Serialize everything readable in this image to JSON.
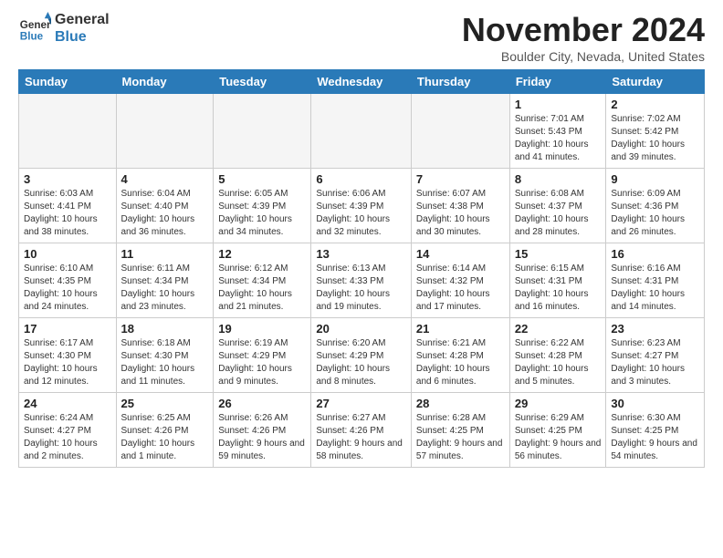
{
  "header": {
    "logo_line1": "General",
    "logo_line2": "Blue",
    "month": "November 2024",
    "location": "Boulder City, Nevada, United States"
  },
  "days_of_week": [
    "Sunday",
    "Monday",
    "Tuesday",
    "Wednesday",
    "Thursday",
    "Friday",
    "Saturday"
  ],
  "weeks": [
    [
      null,
      null,
      null,
      null,
      null,
      {
        "day": "1",
        "sunrise": "7:01 AM",
        "sunset": "5:43 PM",
        "daylight": "10 hours and 41 minutes."
      },
      {
        "day": "2",
        "sunrise": "7:02 AM",
        "sunset": "5:42 PM",
        "daylight": "10 hours and 39 minutes."
      }
    ],
    [
      {
        "day": "3",
        "sunrise": "6:03 AM",
        "sunset": "4:41 PM",
        "daylight": "10 hours and 38 minutes."
      },
      {
        "day": "4",
        "sunrise": "6:04 AM",
        "sunset": "4:40 PM",
        "daylight": "10 hours and 36 minutes."
      },
      {
        "day": "5",
        "sunrise": "6:05 AM",
        "sunset": "4:39 PM",
        "daylight": "10 hours and 34 minutes."
      },
      {
        "day": "6",
        "sunrise": "6:06 AM",
        "sunset": "4:39 PM",
        "daylight": "10 hours and 32 minutes."
      },
      {
        "day": "7",
        "sunrise": "6:07 AM",
        "sunset": "4:38 PM",
        "daylight": "10 hours and 30 minutes."
      },
      {
        "day": "8",
        "sunrise": "6:08 AM",
        "sunset": "4:37 PM",
        "daylight": "10 hours and 28 minutes."
      },
      {
        "day": "9",
        "sunrise": "6:09 AM",
        "sunset": "4:36 PM",
        "daylight": "10 hours and 26 minutes."
      }
    ],
    [
      {
        "day": "10",
        "sunrise": "6:10 AM",
        "sunset": "4:35 PM",
        "daylight": "10 hours and 24 minutes."
      },
      {
        "day": "11",
        "sunrise": "6:11 AM",
        "sunset": "4:34 PM",
        "daylight": "10 hours and 23 minutes."
      },
      {
        "day": "12",
        "sunrise": "6:12 AM",
        "sunset": "4:34 PM",
        "daylight": "10 hours and 21 minutes."
      },
      {
        "day": "13",
        "sunrise": "6:13 AM",
        "sunset": "4:33 PM",
        "daylight": "10 hours and 19 minutes."
      },
      {
        "day": "14",
        "sunrise": "6:14 AM",
        "sunset": "4:32 PM",
        "daylight": "10 hours and 17 minutes."
      },
      {
        "day": "15",
        "sunrise": "6:15 AM",
        "sunset": "4:31 PM",
        "daylight": "10 hours and 16 minutes."
      },
      {
        "day": "16",
        "sunrise": "6:16 AM",
        "sunset": "4:31 PM",
        "daylight": "10 hours and 14 minutes."
      }
    ],
    [
      {
        "day": "17",
        "sunrise": "6:17 AM",
        "sunset": "4:30 PM",
        "daylight": "10 hours and 12 minutes."
      },
      {
        "day": "18",
        "sunrise": "6:18 AM",
        "sunset": "4:30 PM",
        "daylight": "10 hours and 11 minutes."
      },
      {
        "day": "19",
        "sunrise": "6:19 AM",
        "sunset": "4:29 PM",
        "daylight": "10 hours and 9 minutes."
      },
      {
        "day": "20",
        "sunrise": "6:20 AM",
        "sunset": "4:29 PM",
        "daylight": "10 hours and 8 minutes."
      },
      {
        "day": "21",
        "sunrise": "6:21 AM",
        "sunset": "4:28 PM",
        "daylight": "10 hours and 6 minutes."
      },
      {
        "day": "22",
        "sunrise": "6:22 AM",
        "sunset": "4:28 PM",
        "daylight": "10 hours and 5 minutes."
      },
      {
        "day": "23",
        "sunrise": "6:23 AM",
        "sunset": "4:27 PM",
        "daylight": "10 hours and 3 minutes."
      }
    ],
    [
      {
        "day": "24",
        "sunrise": "6:24 AM",
        "sunset": "4:27 PM",
        "daylight": "10 hours and 2 minutes."
      },
      {
        "day": "25",
        "sunrise": "6:25 AM",
        "sunset": "4:26 PM",
        "daylight": "10 hours and 1 minute."
      },
      {
        "day": "26",
        "sunrise": "6:26 AM",
        "sunset": "4:26 PM",
        "daylight": "9 hours and 59 minutes."
      },
      {
        "day": "27",
        "sunrise": "6:27 AM",
        "sunset": "4:26 PM",
        "daylight": "9 hours and 58 minutes."
      },
      {
        "day": "28",
        "sunrise": "6:28 AM",
        "sunset": "4:25 PM",
        "daylight": "9 hours and 57 minutes."
      },
      {
        "day": "29",
        "sunrise": "6:29 AM",
        "sunset": "4:25 PM",
        "daylight": "9 hours and 56 minutes."
      },
      {
        "day": "30",
        "sunrise": "6:30 AM",
        "sunset": "4:25 PM",
        "daylight": "9 hours and 54 minutes."
      }
    ]
  ],
  "labels": {
    "sunrise_prefix": "Sunrise: ",
    "sunset_prefix": "Sunset: ",
    "daylight_prefix": "Daylight: "
  }
}
